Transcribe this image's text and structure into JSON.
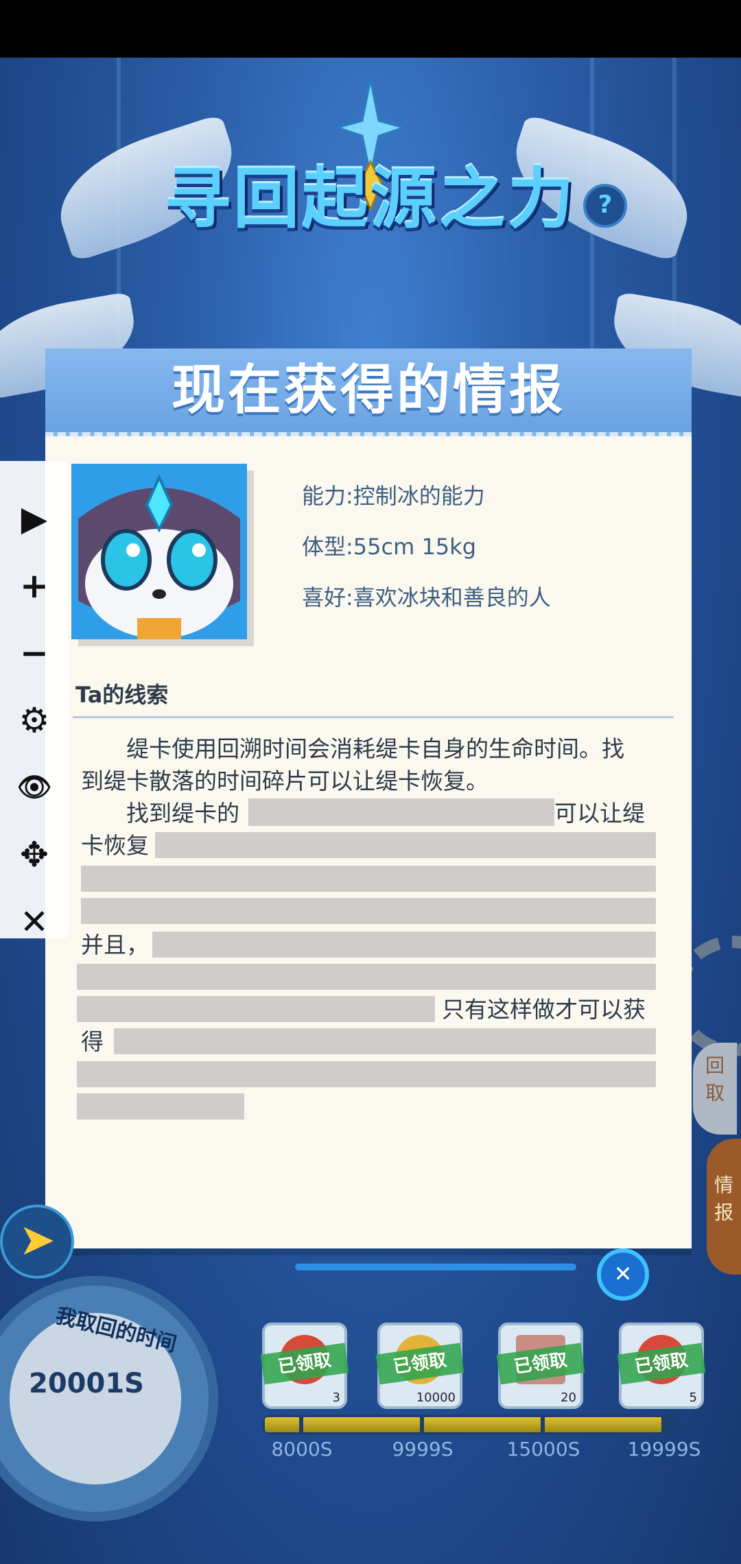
{
  "game_title": "寻回起源之力",
  "help_label": "?",
  "panel": {
    "title": "现在获得的情报",
    "info": {
      "ability": "能力:控制冰的能力",
      "size": "体型:55cm 15kg",
      "likes": "喜好:喜欢冰块和善良的人"
    },
    "clue_title": "Ta的线索",
    "clue_lines": {
      "l1": "　　缇卡使用回溯时间会消耗缇卡自身的生命时间。找",
      "l2": "到缇卡散落的时间碎片可以让缇卡恢复。",
      "l3a": "　　找到缇卡的",
      "l3b": "可以让缇",
      "l4": "卡恢复",
      "l5": "并且，",
      "l6": "只有这样做才可以获",
      "l7": "得"
    }
  },
  "toolbar": {
    "play": "▶",
    "zoom_in": "+",
    "zoom_out": "−",
    "settings": "⚙",
    "view": "👁",
    "move": "✥",
    "close": "✕"
  },
  "side_tabs": {
    "retrieve": "回\n取",
    "intel": "情\n报"
  },
  "clock": {
    "label": "我取回的时间",
    "value": "20001S"
  },
  "rewards": [
    {
      "stamp": "已领取",
      "qty": "3",
      "color": "#d64a3a"
    },
    {
      "stamp": "已领取",
      "qty": "10000",
      "color": "#e2b23a"
    },
    {
      "stamp": "已领取",
      "qty": "20",
      "color": "#c98d84"
    },
    {
      "stamp": "已领取",
      "qty": "5",
      "color": "#d64a3a"
    }
  ],
  "milestones": [
    "8000S",
    "9999S",
    "15000S",
    "19999S"
  ],
  "milestone_progress": 0.97
}
